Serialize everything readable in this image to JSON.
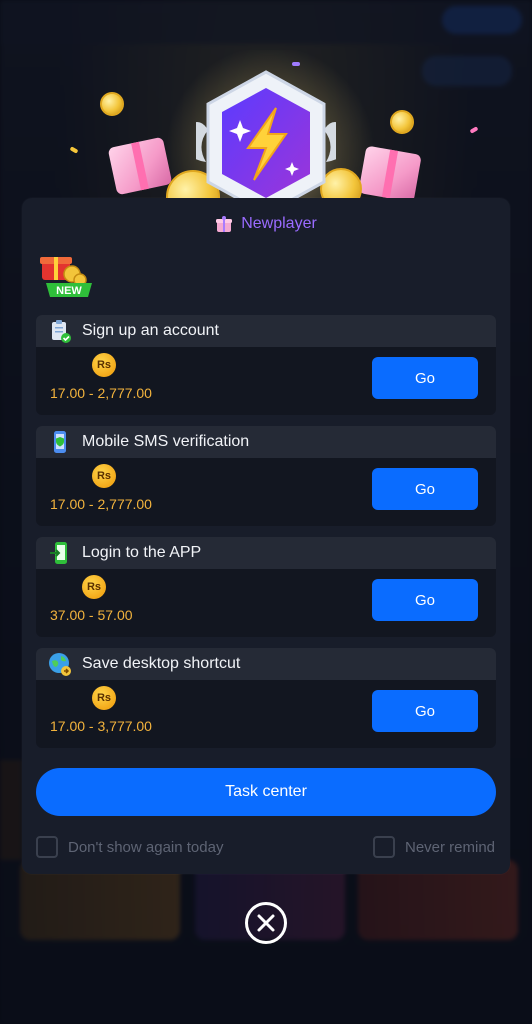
{
  "modal": {
    "title": "Newplayer",
    "new_badge_text": "NEW",
    "tasks": [
      {
        "label": "Sign up an account",
        "icon": "clipboard-check-icon",
        "currency": "Rs",
        "range": "17.00 - 2,777.00",
        "button": "Go"
      },
      {
        "label": "Mobile SMS verification",
        "icon": "shield-phone-icon",
        "currency": "Rs",
        "range": "17.00 - 2,777.00",
        "button": "Go"
      },
      {
        "label": "Login to the APP",
        "icon": "phone-login-icon",
        "currency": "Rs",
        "range": "37.00 - 57.00",
        "button": "Go"
      },
      {
        "label": "Save desktop shortcut",
        "icon": "globe-shortcut-icon",
        "currency": "Rs",
        "range": "17.00 - 3,777.00",
        "button": "Go"
      }
    ],
    "task_center_label": "Task center",
    "dont_show_label": "Don't show again today",
    "never_remind_label": "Never remind"
  },
  "colors": {
    "accent_blue": "#0a6cff",
    "title_purple": "#9a6bff",
    "amount_orange": "#f2b33d",
    "modal_bg": "#181d2a"
  }
}
